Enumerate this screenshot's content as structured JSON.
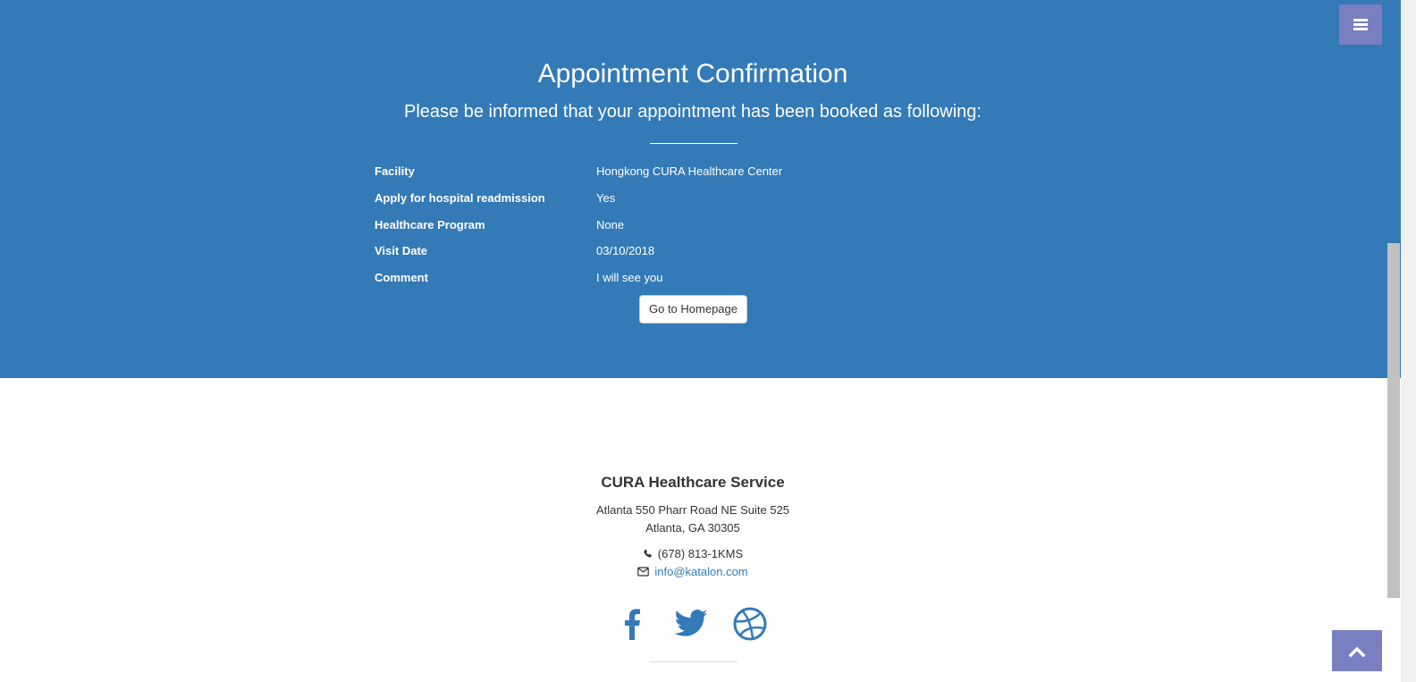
{
  "confirmation": {
    "title": "Appointment Confirmation",
    "subtitle": "Please be informed that your appointment has been booked as following:",
    "details": [
      {
        "label": "Facility",
        "value": "Hongkong CURA Healthcare Center"
      },
      {
        "label": "Apply for hospital readmission",
        "value": "Yes"
      },
      {
        "label": "Healthcare Program",
        "value": "None"
      },
      {
        "label": "Visit Date",
        "value": "03/10/2018"
      },
      {
        "label": "Comment",
        "value": "I will see you"
      }
    ],
    "homepage_button_label": "Go to Homepage"
  },
  "footer": {
    "title": "CURA Healthcare Service",
    "address_line1": "Atlanta 550 Pharr Road NE Suite 525",
    "address_line2": "Atlanta, GA 30305",
    "phone": "(678) 813-1KMS",
    "email": "info@katalon.com",
    "social": [
      "facebook-icon",
      "twitter-icon",
      "dribbble-icon"
    ]
  },
  "colors": {
    "primary_blue": "#337ab7",
    "menu_purple": "#7a7fc1",
    "footer_text": "#333333"
  },
  "icons": {
    "menu": "hamburger-icon",
    "scroll_top": "chevron-up-icon",
    "phone": "phone-icon",
    "email": "envelope-icon"
  }
}
